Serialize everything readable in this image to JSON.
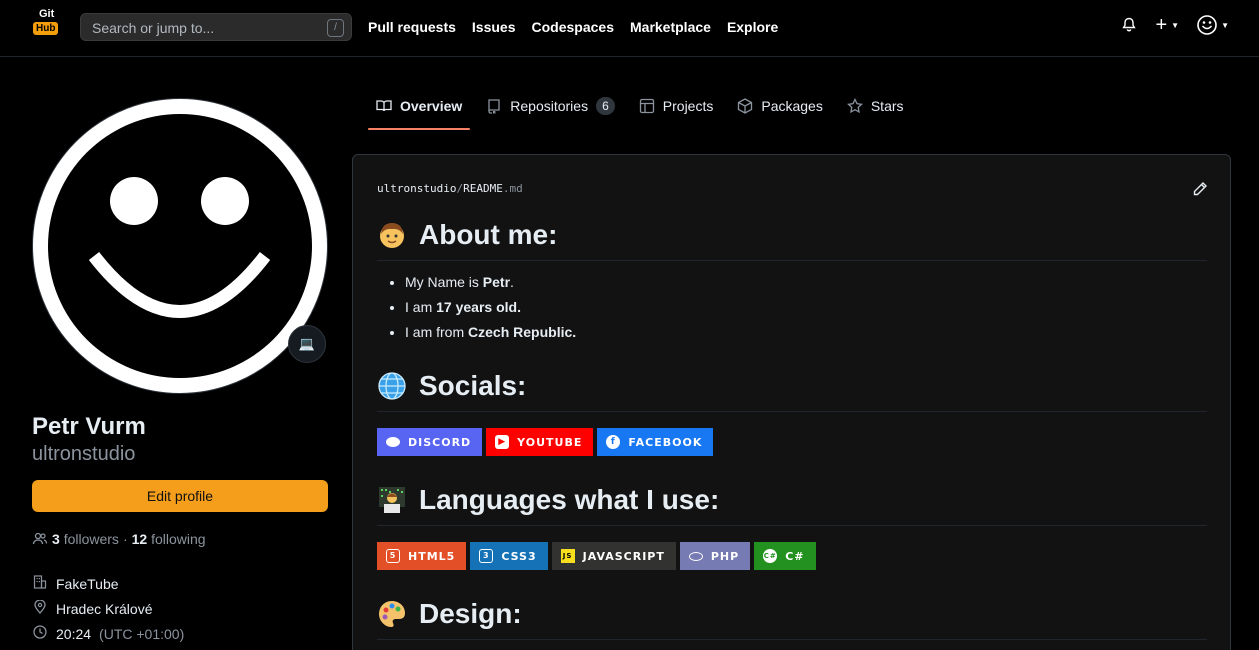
{
  "header": {
    "logo_top": "Git",
    "logo_bottom": "Hub",
    "search_placeholder": "Search or jump to...",
    "search_shortcut": "/",
    "nav": [
      "Pull requests",
      "Issues",
      "Codespaces",
      "Marketplace",
      "Explore"
    ]
  },
  "profile": {
    "status_icon": "laptop-icon",
    "name": "Petr Vurm",
    "login": "ultronstudio",
    "edit_label": "Edit profile",
    "followers_count": "3",
    "followers_label": "followers",
    "separator": "·",
    "following_count": "12",
    "following_label": "following",
    "company": "FakeTube",
    "location": "Hradec Králové",
    "time": "20:24",
    "timezone": "(UTC +01:00)"
  },
  "tabs": [
    {
      "label": "Overview",
      "icon": "book-icon",
      "active": true
    },
    {
      "label": "Repositories",
      "icon": "repo-icon",
      "count": "6"
    },
    {
      "label": "Projects",
      "icon": "table-icon"
    },
    {
      "label": "Packages",
      "icon": "package-icon"
    },
    {
      "label": "Stars",
      "icon": "star-icon"
    }
  ],
  "readme": {
    "owner": "ultronstudio",
    "sep": "/",
    "file": "README",
    "ext": ".md",
    "about_title": "About me:",
    "about_items": [
      {
        "pre": "My Name is ",
        "bold": "Petr",
        "post": "."
      },
      {
        "pre": "I am ",
        "bold": "17 years old.",
        "post": ""
      },
      {
        "pre": "I am from ",
        "bold": "Czech Republic.",
        "post": ""
      }
    ],
    "socials_title": "Socials:",
    "socials": [
      {
        "label": "DISCORD",
        "color": "#5865F2"
      },
      {
        "label": "YOUTUBE",
        "color": "#FF0000"
      },
      {
        "label": "FACEBOOK",
        "color": "#1877F2"
      }
    ],
    "languages_title": "Languages what I use:",
    "languages": [
      {
        "label": "HTML5",
        "color": "#E34F26"
      },
      {
        "label": "CSS3",
        "color": "#1572B6"
      },
      {
        "label": "JAVASCRIPT",
        "color": "#323330"
      },
      {
        "label": "PHP",
        "color": "#777BB4"
      },
      {
        "label": "C#",
        "color": "#239120"
      }
    ],
    "design_title": "Design:"
  }
}
